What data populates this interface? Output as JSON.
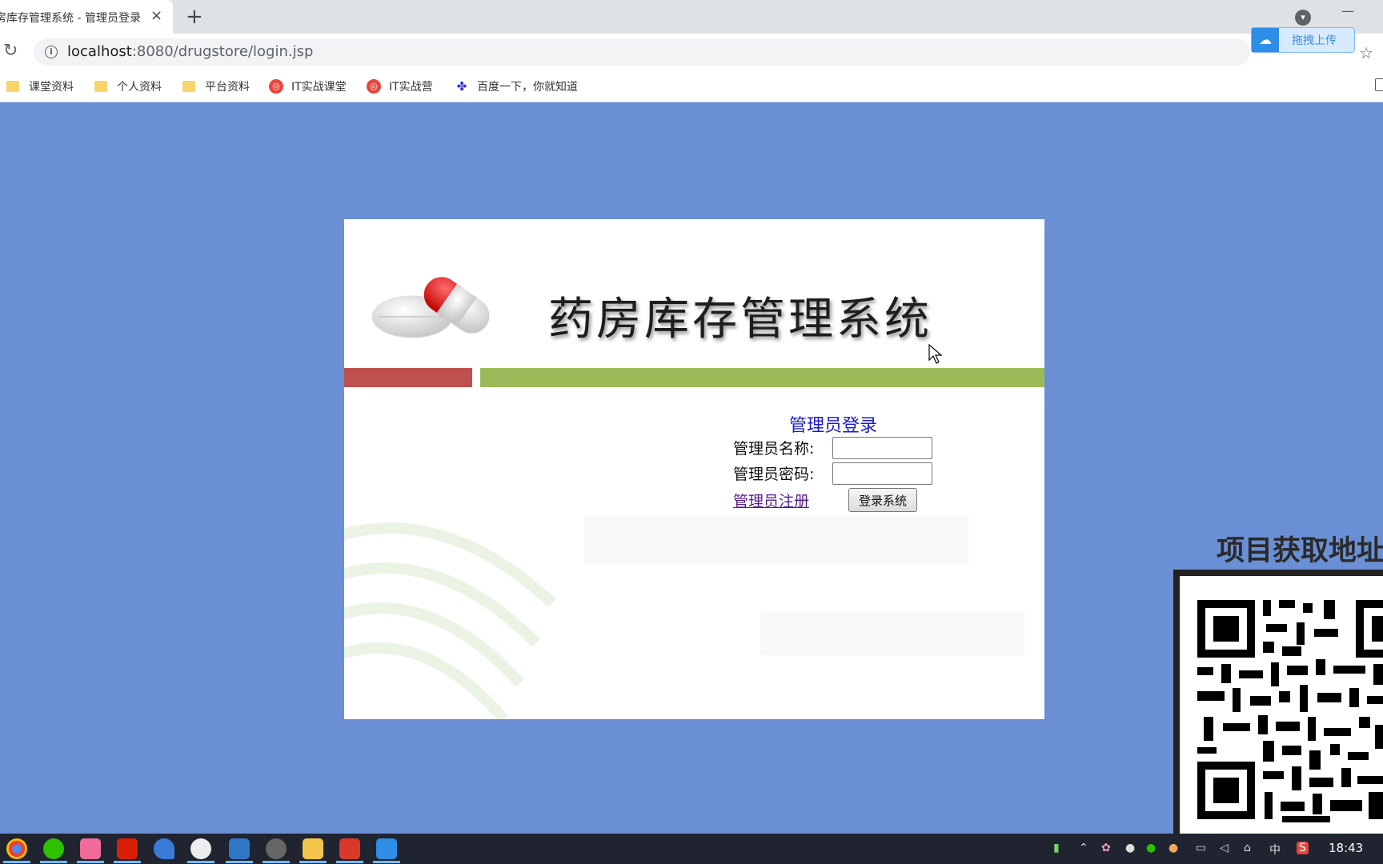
{
  "browser": {
    "tab_title": "药房库存管理系统 - 管理员登录",
    "tab_close": "×",
    "new_tab": "+",
    "url_host": "localhost",
    "url_path": ":8080/drugstore/login.jsp",
    "upload_label": "拖拽上传",
    "bookmarks": [
      {
        "label": "课堂资料",
        "icon": "folder-icon"
      },
      {
        "label": "个人资料",
        "icon": "folder-icon"
      },
      {
        "label": "平台资料",
        "icon": "folder-icon"
      },
      {
        "label": "IT实战课堂",
        "icon": "it-logo-icon"
      },
      {
        "label": "IT实战营",
        "icon": "it-logo-icon"
      },
      {
        "label": "百度一下，你就知道",
        "icon": "baidu-paw-icon"
      }
    ]
  },
  "page": {
    "system_title": "药房库存管理系统",
    "login_title": "管理员登录",
    "name_label": "管理员名称:",
    "password_label": "管理员密码:",
    "name_value": "",
    "password_value": "",
    "register_link": "管理员注册",
    "login_button": "登录系统",
    "colors": {
      "background": "#6b8fd4",
      "red_bar": "#c0504d",
      "green_bar": "#9bbb59",
      "login_title": "#1a1acc"
    }
  },
  "overlay": {
    "qr_title": "项目获取地址"
  },
  "taskbar": {
    "apps": [
      "chrome-icon",
      "wechat-icon",
      "app-pink-icon",
      "netease-music-icon",
      "dolphin-icon",
      "camera-icon",
      "photos-icon",
      "settings-icon",
      "file-explorer-icon",
      "wps-icon",
      "baidu-netdisk-icon"
    ],
    "time": "18:43"
  }
}
